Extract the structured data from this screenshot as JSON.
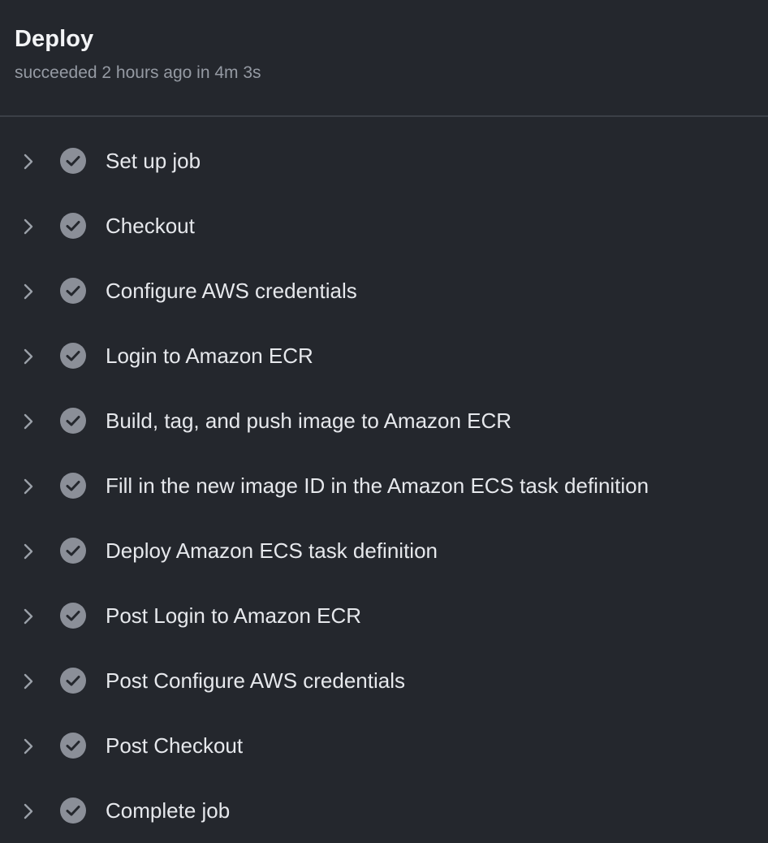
{
  "job": {
    "title": "Deploy",
    "status": "succeeded 2 hours ago in 4m 3s"
  },
  "colors": {
    "background": "#24272d",
    "divider": "#3b3f46",
    "check_fill": "#8b8f98",
    "check_mark": "#24272d",
    "chevron": "#9aa0a8",
    "title_text": "#f3f4f6",
    "subtitle_text": "#959aa3"
  },
  "steps": [
    {
      "label": "Set up job",
      "status_icon": "check-circle-icon"
    },
    {
      "label": "Checkout",
      "status_icon": "check-circle-icon"
    },
    {
      "label": "Configure AWS credentials",
      "status_icon": "check-circle-icon"
    },
    {
      "label": "Login to Amazon ECR",
      "status_icon": "check-circle-icon"
    },
    {
      "label": "Build, tag, and push image to Amazon ECR",
      "status_icon": "check-circle-icon"
    },
    {
      "label": "Fill in the new image ID in the Amazon ECS task definition",
      "status_icon": "check-circle-icon"
    },
    {
      "label": "Deploy Amazon ECS task definition",
      "status_icon": "check-circle-icon"
    },
    {
      "label": "Post Login to Amazon ECR",
      "status_icon": "check-circle-icon"
    },
    {
      "label": "Post Configure AWS credentials",
      "status_icon": "check-circle-icon"
    },
    {
      "label": "Post Checkout",
      "status_icon": "check-circle-icon"
    },
    {
      "label": "Complete job",
      "status_icon": "check-circle-icon"
    }
  ]
}
